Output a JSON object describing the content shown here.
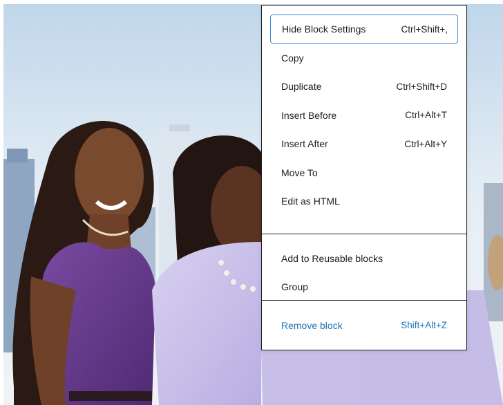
{
  "menu": {
    "items": [
      {
        "label": "Hide Block Settings",
        "shortcut": "Ctrl+Shift+,"
      },
      {
        "label": "Copy",
        "shortcut": ""
      },
      {
        "label": "Duplicate",
        "shortcut": "Ctrl+Shift+D"
      },
      {
        "label": "Insert Before",
        "shortcut": "Ctrl+Alt+T"
      },
      {
        "label": "Insert After",
        "shortcut": "Ctrl+Alt+Y"
      },
      {
        "label": "Move To",
        "shortcut": ""
      },
      {
        "label": "Edit as HTML",
        "shortcut": ""
      },
      {
        "label": "Add to Reusable blocks",
        "shortcut": ""
      },
      {
        "label": "Group",
        "shortcut": ""
      },
      {
        "label": "Remove block",
        "shortcut": "Shift+Alt+Z"
      }
    ]
  },
  "colors": {
    "focus_ring": "#3c8ad8",
    "danger_text": "#2271b1",
    "menu_border": "#1e1e1e"
  }
}
